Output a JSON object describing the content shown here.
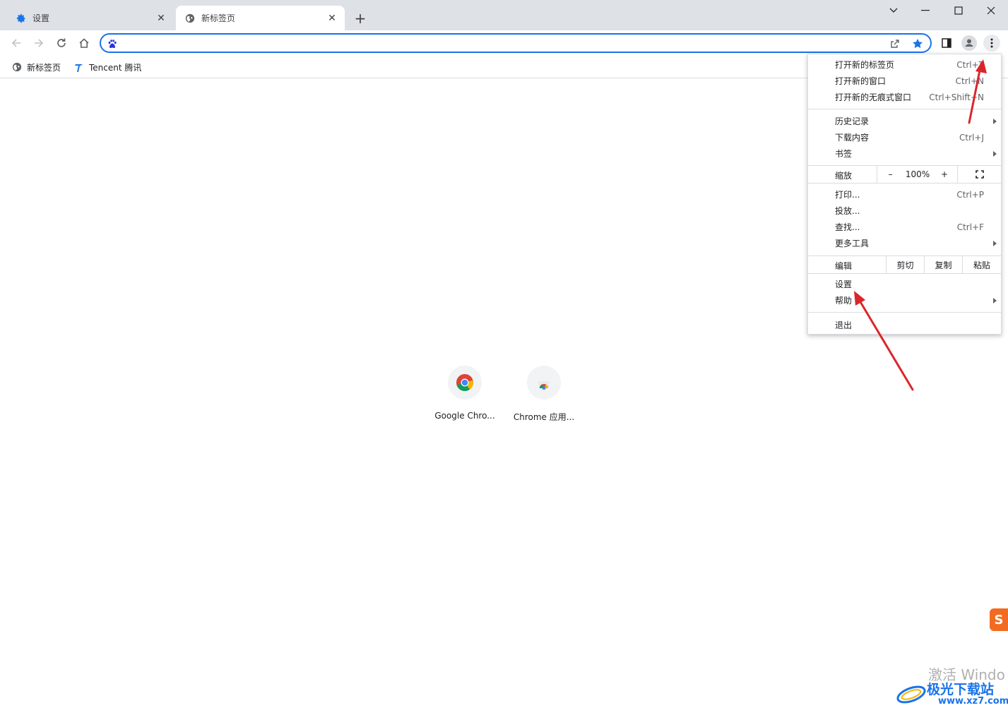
{
  "tabs": [
    {
      "title": "设置",
      "icon": "gear-icon"
    },
    {
      "title": "新标签页",
      "icon": "globe-icon"
    }
  ],
  "omnibox": {
    "value": "",
    "placeholder": ""
  },
  "bookmarks": [
    {
      "label": "新标签页",
      "icon": "globe-icon"
    },
    {
      "label": "Tencent 腾讯",
      "icon": "tencent-icon"
    }
  ],
  "shortcuts": [
    {
      "label": "Google Chro...",
      "icon": "chrome-logo-icon"
    },
    {
      "label": "Chrome 应用...",
      "icon": "chrome-webstore-icon"
    }
  ],
  "menu": {
    "new_tab": {
      "label": "打开新的标签页",
      "key": "Ctrl+T"
    },
    "new_window": {
      "label": "打开新的窗口",
      "key": "Ctrl+N"
    },
    "new_incognito": {
      "label": "打开新的无痕式窗口",
      "key": "Ctrl+Shift+N"
    },
    "history": {
      "label": "历史记录"
    },
    "downloads": {
      "label": "下载内容",
      "key": "Ctrl+J"
    },
    "bookmarks": {
      "label": "书签"
    },
    "zoom": {
      "label": "缩放",
      "minus": "–",
      "value": "100%",
      "plus": "+"
    },
    "print": {
      "label": "打印...",
      "key": "Ctrl+P"
    },
    "cast": {
      "label": "投放..."
    },
    "find": {
      "label": "查找...",
      "key": "Ctrl+F"
    },
    "more_tools": {
      "label": "更多工具"
    },
    "edit": {
      "label": "编辑",
      "cut": "剪切",
      "copy": "复制",
      "paste": "粘贴"
    },
    "settings": {
      "label": "设置"
    },
    "help": {
      "label": "帮助"
    },
    "exit": {
      "label": "退出"
    }
  },
  "watermark": {
    "activate": "激活 Windo",
    "site_title": "极光下载站",
    "site_url": "www.xz7.com"
  },
  "colors": {
    "accent": "#1a73e8",
    "arrow": "#d9262c",
    "tabstrip": "#dee1e6"
  }
}
